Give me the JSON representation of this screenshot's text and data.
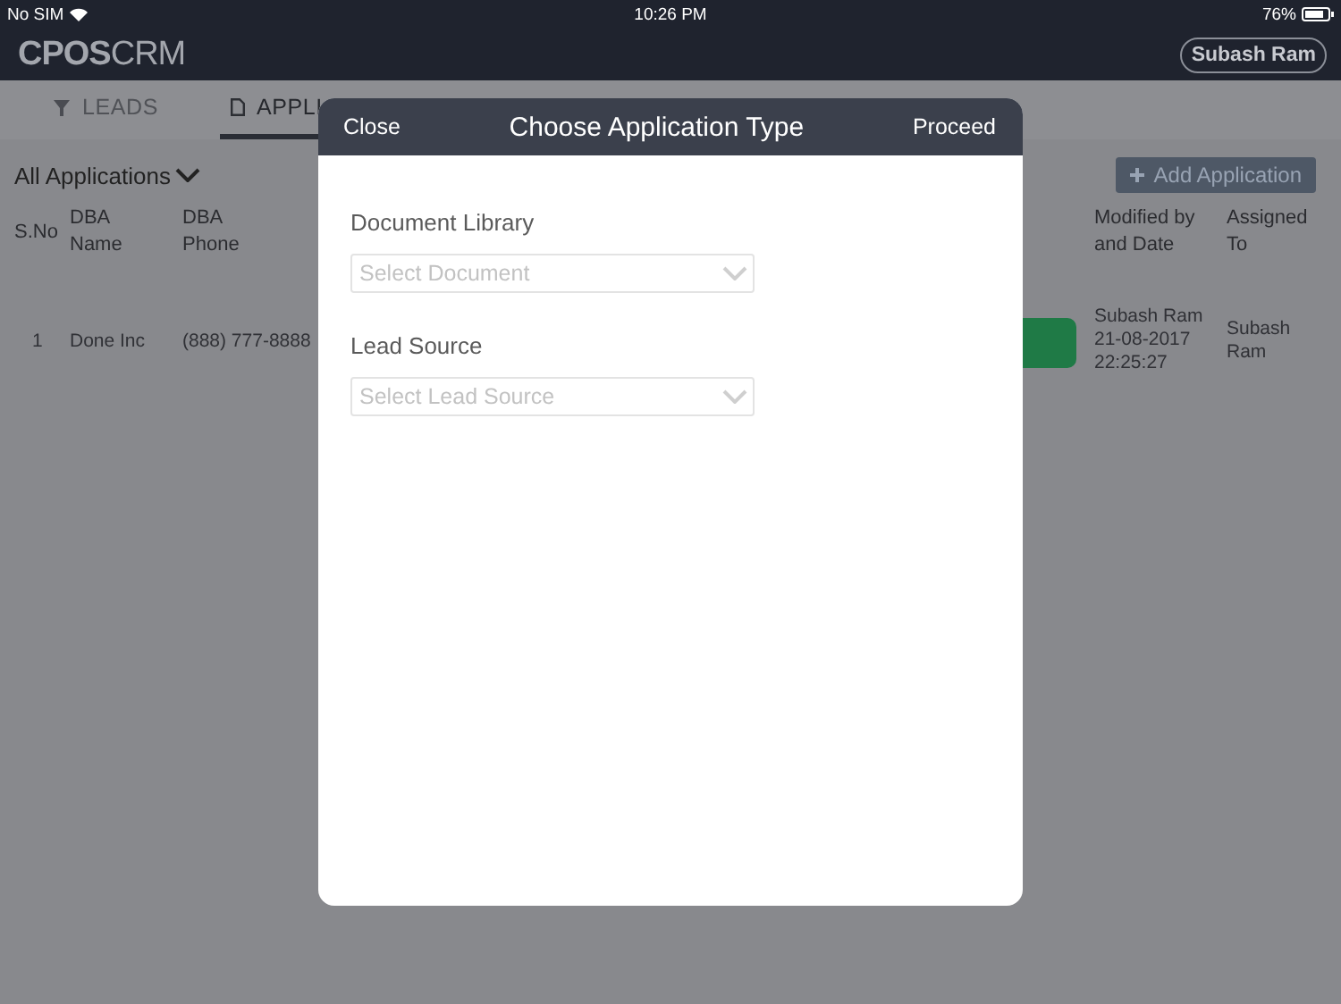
{
  "status_bar": {
    "carrier": "No SIM",
    "time": "10:26 PM",
    "battery": "76%"
  },
  "header": {
    "logo": "**CPOS**CRM",
    "user_button": "Subash Ram"
  },
  "tabs": [
    {
      "label": "LEADS",
      "selected": false
    },
    {
      "label": "APPLI",
      "selected": true
    }
  ],
  "filter": {
    "label": "All Applications"
  },
  "add_button": {
    "label": "Add Application"
  },
  "table": {
    "columns": [
      "S.No",
      "DBA Name",
      "DBA Phone",
      "Modified by and Date",
      "Assigned To"
    ],
    "rows": [
      {
        "sno": "1",
        "dba_name": "Done Inc",
        "dba_phone": "(888) 777-8888",
        "color": "#1f7a46",
        "modified": "Subash Ram 21-08-2017 22:25:27",
        "assigned": "Subash Ram"
      }
    ]
  },
  "modal": {
    "close": "Close",
    "title": "Choose Application Type",
    "proceed": "Proceed",
    "fields": [
      {
        "label": "Document Library",
        "placeholder": "Select Document"
      },
      {
        "label": "Lead Source",
        "placeholder": "Select Lead Source"
      }
    ]
  }
}
